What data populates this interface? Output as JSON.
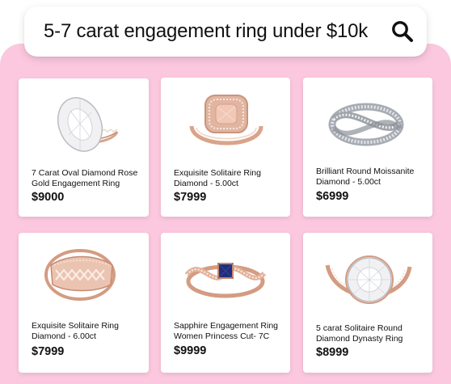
{
  "search": {
    "query": "5-7 carat engagement ring under $10k",
    "icon": "search-icon"
  },
  "colors": {
    "panel_background": "#fcc8df",
    "card_background": "#ffffff",
    "text": "#111111",
    "rose_gold": "#d9a48a",
    "silver": "#bfc3c9",
    "sapphire": "#1f2d7a"
  },
  "products": [
    {
      "title": "7 Carat Oval Diamond Rose Gold Engagement Ring",
      "price": "$9000",
      "image": "oval-diamond-rose-gold-ring"
    },
    {
      "title": "Exquisite Solitaire Ring Diamond - 5.00ct",
      "price": "$7999",
      "image": "cushion-halo-morganite-ring"
    },
    {
      "title": "Brilliant Round Moissanite Diamond - 5.00ct",
      "price": "$6999",
      "image": "crossover-pave-silver-ring"
    },
    {
      "title": "Exquisite Solitaire Ring Diamond - 6.00ct",
      "price": "$7999",
      "image": "wide-lattice-band-ring"
    },
    {
      "title": "Sapphire Engagement Ring Women Princess Cut- 7C",
      "price": "$9999",
      "image": "sapphire-twist-ring"
    },
    {
      "title": "5 carat Solitaire Round Diamond Dynasty Ring",
      "price": "$8999",
      "image": "round-solitaire-rose-gold-ring"
    }
  ]
}
